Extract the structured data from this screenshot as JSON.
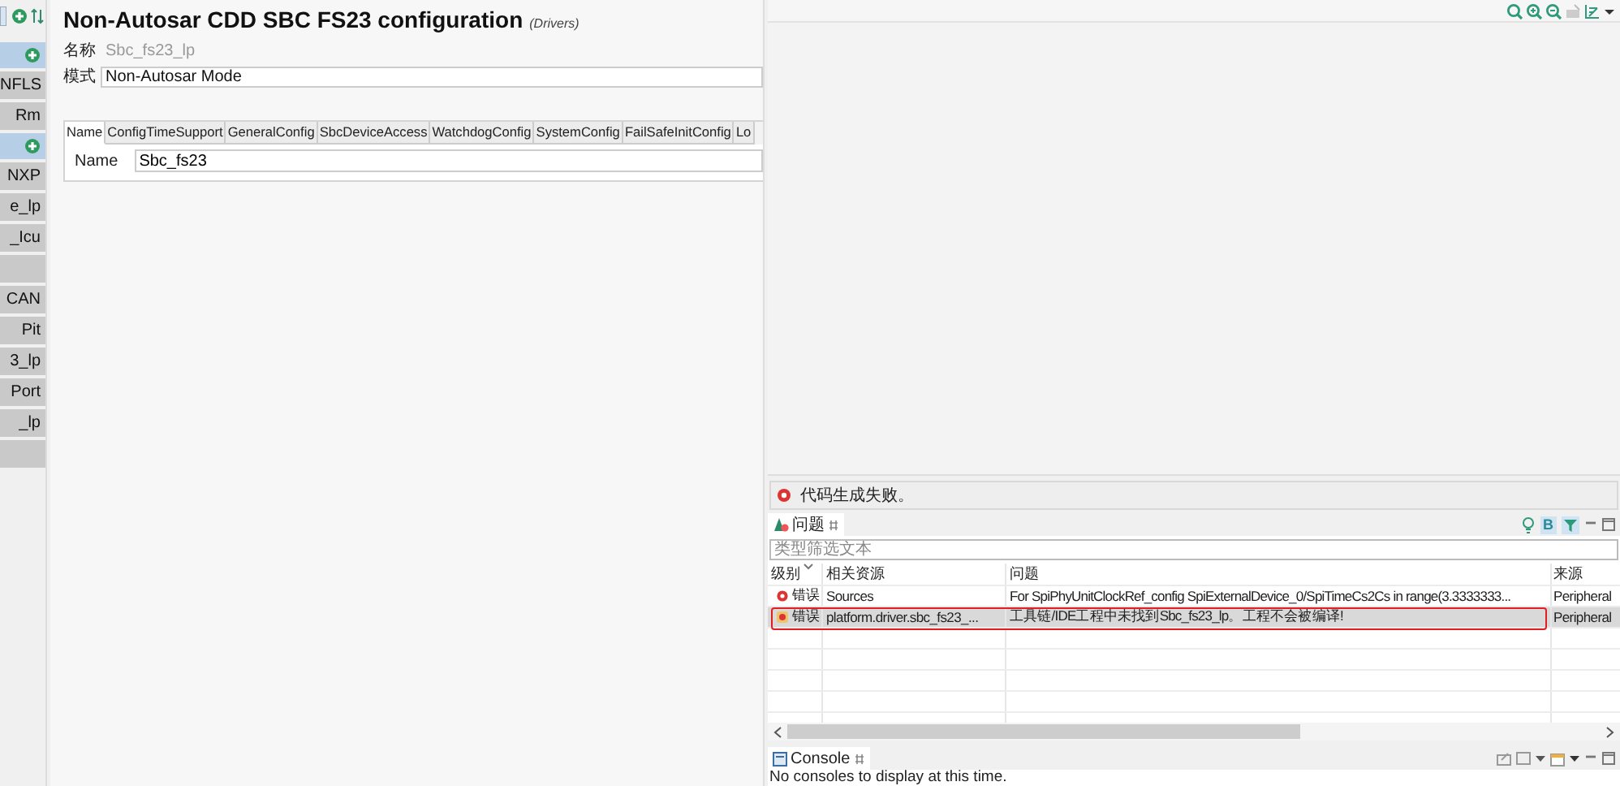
{
  "sidebar": {
    "items": [
      {
        "kind": "group"
      },
      {
        "kind": "item",
        "label": "NFLS"
      },
      {
        "kind": "item",
        "label": "Rm"
      },
      {
        "kind": "group"
      },
      {
        "kind": "item",
        "label": "NXP"
      },
      {
        "kind": "item",
        "label": "e_lp"
      },
      {
        "kind": "item",
        "label": "_Icu"
      },
      {
        "kind": "blank"
      },
      {
        "kind": "item",
        "label": "CAN"
      },
      {
        "kind": "item",
        "label": "Pit"
      },
      {
        "kind": "item",
        "label": "3_lp"
      },
      {
        "kind": "item",
        "label": "Port"
      },
      {
        "kind": "item",
        "label": "_lp"
      },
      {
        "kind": "blank"
      }
    ]
  },
  "editor": {
    "title": "Non-Autosar CDD SBC FS23 configuration",
    "subtitle": "(Drivers)",
    "fields": [
      {
        "label": "名称",
        "value": "Sbc_fs23_lp",
        "disabled": true
      },
      {
        "label": "模式",
        "value": "Non-Autosar Mode",
        "disabled": false
      }
    ],
    "tabs": [
      {
        "label": "Name",
        "selected": true
      },
      {
        "label": "ConfigTimeSupport",
        "selected": false
      },
      {
        "label": "GeneralConfig",
        "selected": false
      },
      {
        "label": "SbcDeviceAccess",
        "selected": false
      },
      {
        "label": "WatchdogConfig",
        "selected": false
      },
      {
        "label": "SystemConfig",
        "selected": false
      },
      {
        "label": "FailSafeInitConfig",
        "selected": false
      },
      {
        "label": "Lo",
        "selected": false
      }
    ],
    "tab_content": {
      "label": "Name",
      "value": "Sbc_fs23"
    }
  },
  "status_message": "代码生成失败。",
  "problems": {
    "tab": "问题",
    "toggle_label": "B",
    "filter": {
      "placeholder": "类型筛选文本"
    },
    "columns": [
      "级别",
      "相关资源",
      "问题",
      "来源"
    ],
    "rows": [
      {
        "level": "错误",
        "resource": "Sources",
        "problem": "For SpiPhyUnitClockRef_config SpiExternalDevice_0/SpiTimeCs2Cs in range(3.3333333...",
        "source": "Peripheral",
        "selected": false,
        "highlighted": false
      },
      {
        "level": "错误",
        "resource": "platform.driver.sbc_fs23_...",
        "problem": "工具链/IDE工程中未找到Sbc_fs23_lp。工程不会被编译!",
        "source": "Peripheral",
        "selected": true,
        "highlighted": true
      }
    ]
  },
  "console": {
    "tab": "Console",
    "message": "No consoles to display at this time."
  }
}
